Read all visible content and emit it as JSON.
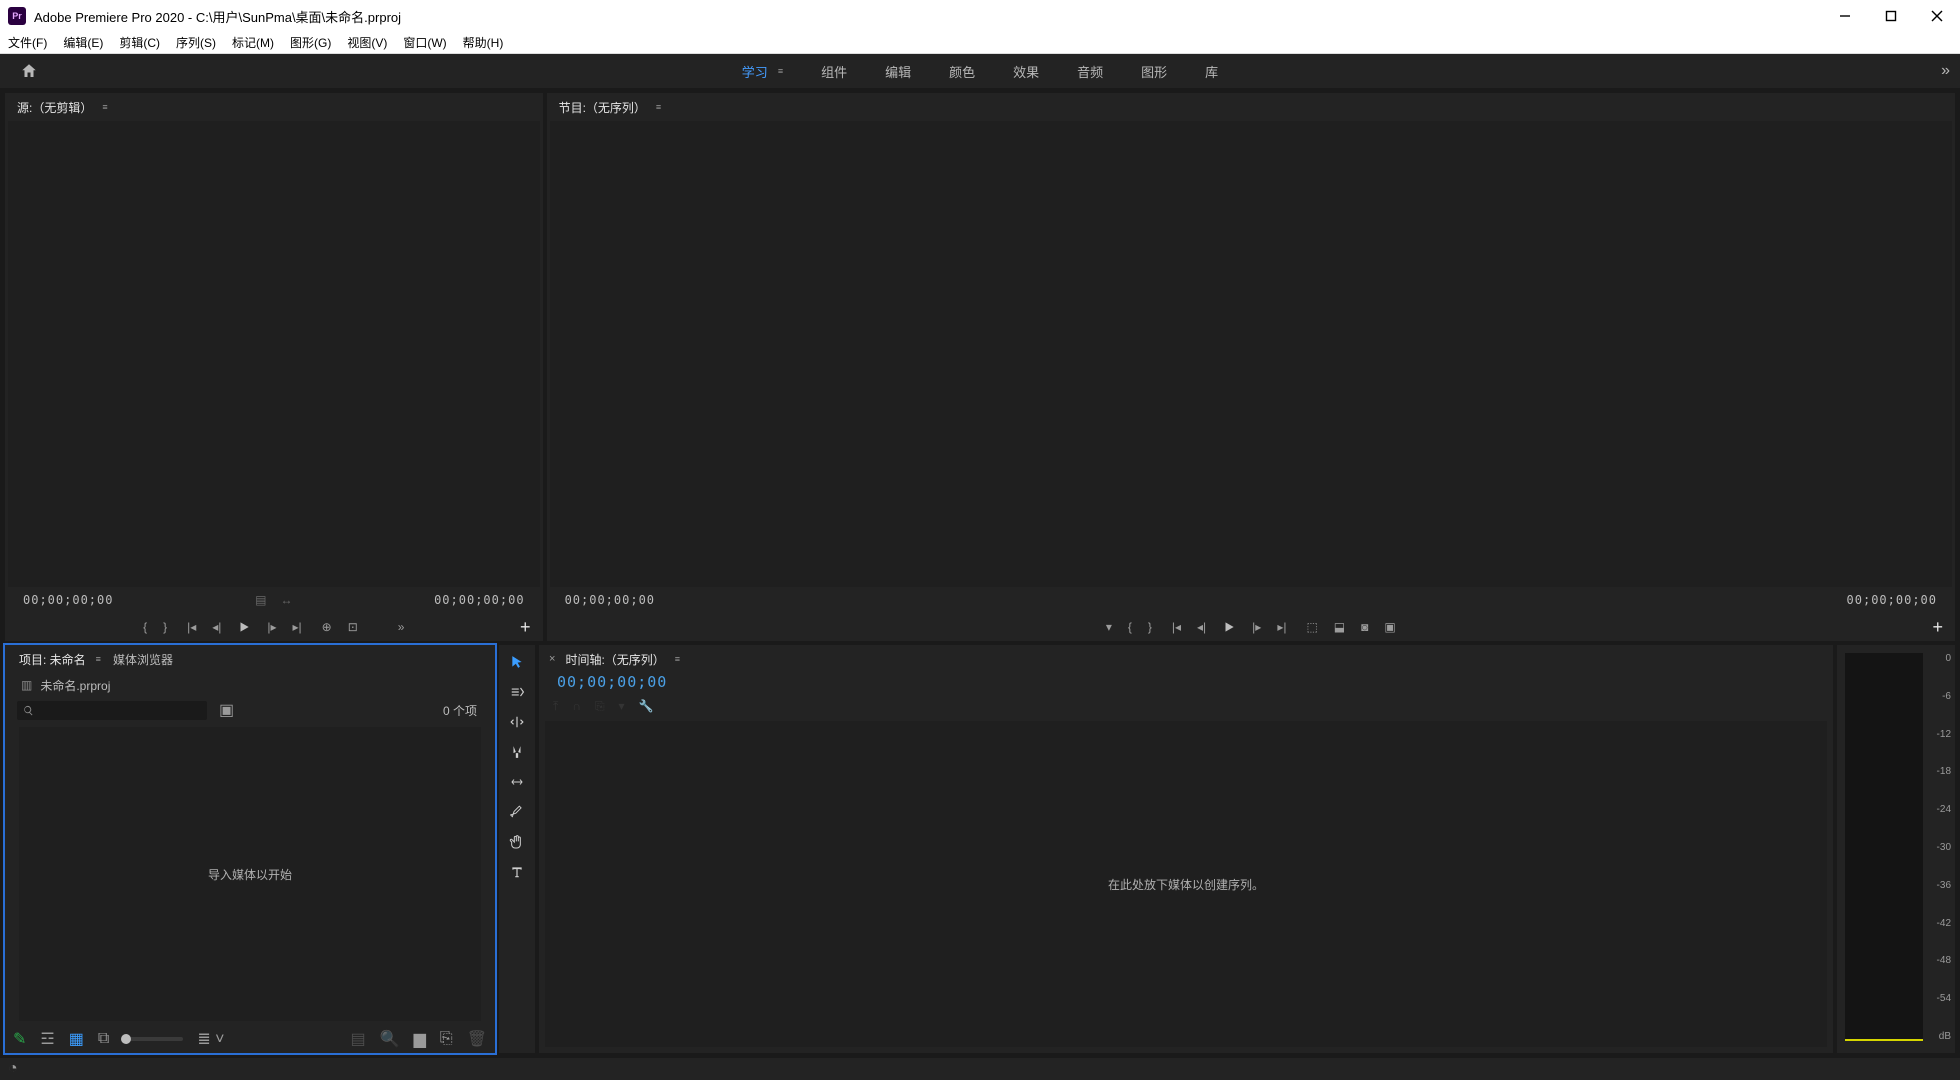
{
  "titlebar": {
    "logo": "Pr",
    "title": "Adobe Premiere Pro 2020 - C:\\用户\\SunPma\\桌面\\未命名.prproj"
  },
  "menubar": [
    "文件(F)",
    "编辑(E)",
    "剪辑(C)",
    "序列(S)",
    "标记(M)",
    "图形(G)",
    "视图(V)",
    "窗口(W)",
    "帮助(H)"
  ],
  "workspaces": {
    "items": [
      "学习",
      "组件",
      "编辑",
      "颜色",
      "效果",
      "音频",
      "图形",
      "库"
    ],
    "active": 0
  },
  "source": {
    "tab": "源:（无剪辑）",
    "tc_left": "00;00;00;00",
    "tc_right": "00;00;00;00"
  },
  "program": {
    "tab": "节目:（无序列）",
    "tc_left": "00;00;00;00",
    "tc_right": "00;00;00;00"
  },
  "project": {
    "tabs": [
      "项目: 未命名",
      "媒体浏览器"
    ],
    "filename": "未命名.prproj",
    "count": "0 个项",
    "drop_hint": "导入媒体以开始",
    "search_placeholder": ""
  },
  "timeline": {
    "tab": "时间轴:（无序列）",
    "tc": "00;00;00;00",
    "drop_hint": "在此处放下媒体以创建序列。"
  },
  "audio_scale": [
    "0",
    "-6",
    "-12",
    "-18",
    "-24",
    "-30",
    "-36",
    "-42",
    "-48",
    "-54",
    "dB"
  ]
}
